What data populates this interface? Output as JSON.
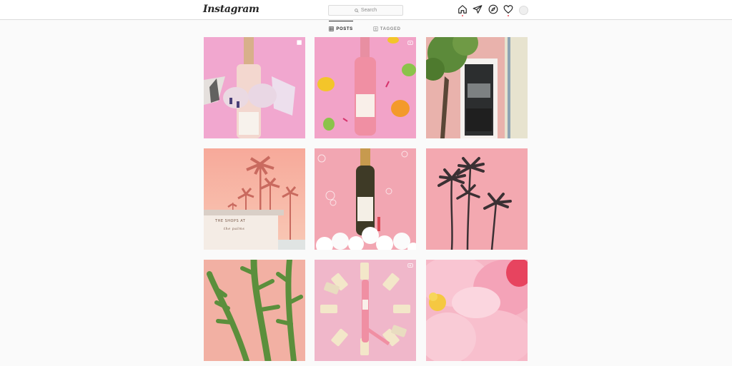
{
  "header": {
    "logo": "Instagram",
    "search_placeholder": "Search"
  },
  "nav_icons": [
    "home-icon",
    "direct-icon",
    "explore-icon",
    "activity-icon",
    "profile-avatar"
  ],
  "tabs": [
    {
      "label": "POSTS",
      "active": true,
      "icon": "grid-icon"
    },
    {
      "label": "TAGGED",
      "active": false,
      "icon": "tag-icon"
    }
  ],
  "posts": [
    {
      "subject": "hands holding rosé bottle bursting through pink paper",
      "badge": "multiple-posts-icon"
    },
    {
      "subject": "rosé bottle with lemons and limes on pink",
      "badge": "video-icon"
    },
    {
      "subject": "pink building with window and tree",
      "badge": ""
    },
    {
      "subject": "palm trees and building sign",
      "badge": "",
      "sign_text": [
        "THE SHOPS AT",
        "the palms"
      ]
    },
    {
      "subject": "sparkling wine bottle with bubbles",
      "badge": ""
    },
    {
      "subject": "palm tree silhouettes on pink",
      "badge": ""
    },
    {
      "subject": "cactus against pink wall",
      "badge": ""
    },
    {
      "subject": "cans arranged around rosé bottle",
      "badge": "video-icon"
    },
    {
      "subject": "pink peony flower close-up",
      "badge": ""
    }
  ],
  "colors": {
    "accent_dot": "#ed4956",
    "border": "#dbdbdb",
    "background": "#fafafa"
  }
}
